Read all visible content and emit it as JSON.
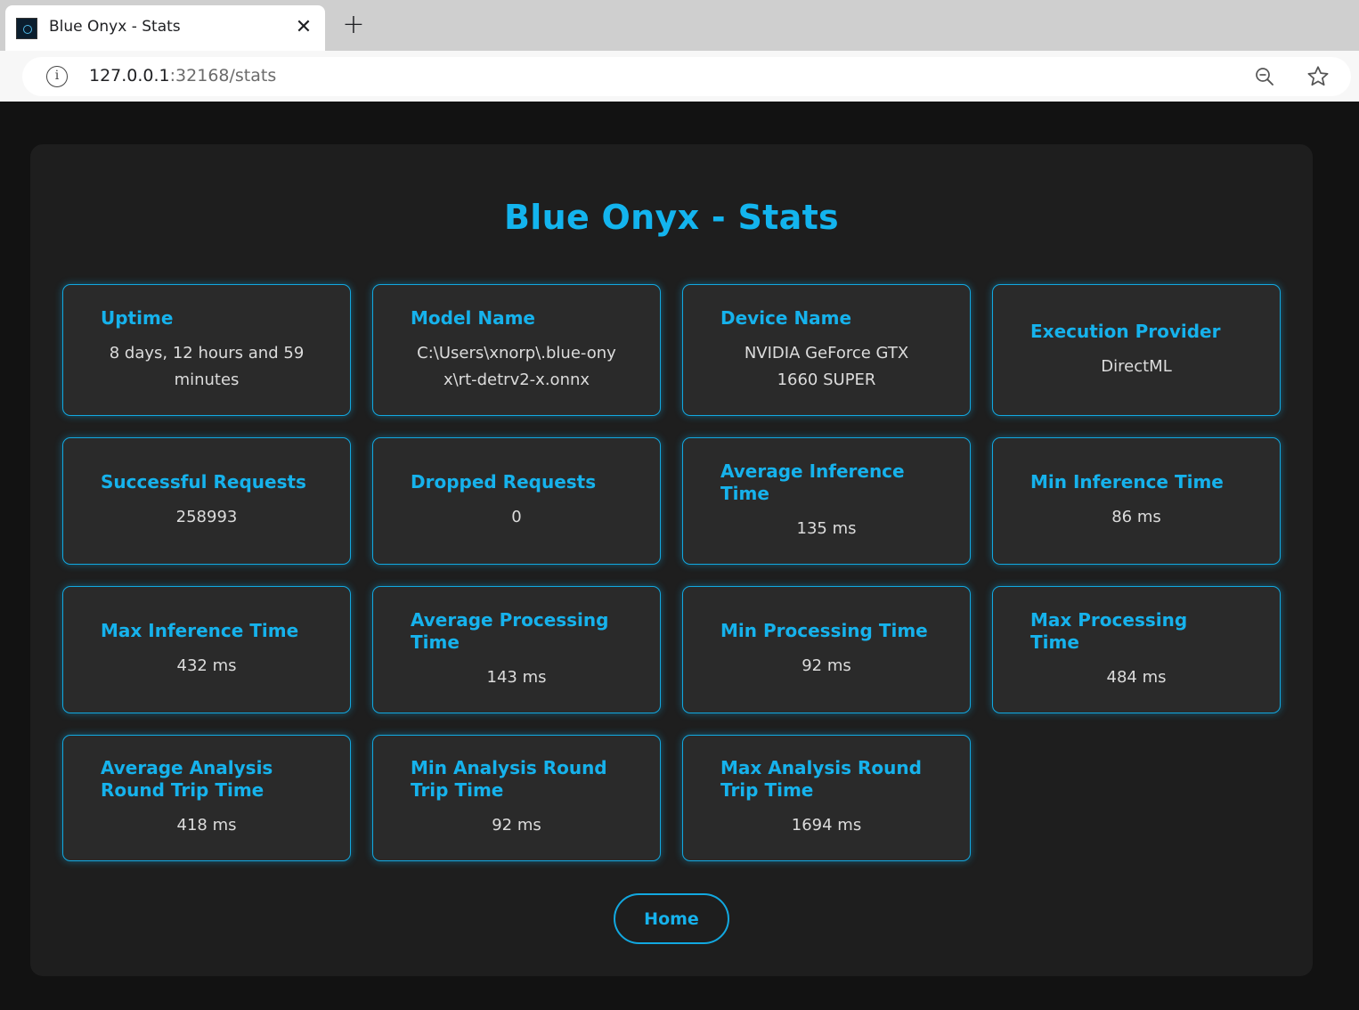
{
  "browser": {
    "tab_title": "Blue Onyx - Stats",
    "tab_close": "✕",
    "new_tab": "+",
    "url_host": "127.0.0.1",
    "url_rest": ":32168/stats"
  },
  "page": {
    "title": "Blue Onyx - Stats",
    "home_label": "Home"
  },
  "stats": [
    {
      "label": "Uptime",
      "value": "8 days, 12 hours and 59 minutes"
    },
    {
      "label": "Model Name",
      "value": "C:\\Users\\xnorp\\.blue-onyx\\rt-detrv2-x.onnx"
    },
    {
      "label": "Device Name",
      "value": "NVIDIA GeForce GTX 1660 SUPER"
    },
    {
      "label": "Execution Provider",
      "value": "DirectML"
    },
    {
      "label": "Successful Requests",
      "value": "258993"
    },
    {
      "label": "Dropped Requests",
      "value": "0"
    },
    {
      "label": "Average Inference Time",
      "value": "135 ms"
    },
    {
      "label": "Min Inference Time",
      "value": "86 ms"
    },
    {
      "label": "Max Inference Time",
      "value": "432 ms"
    },
    {
      "label": "Average Processing Time",
      "value": "143 ms"
    },
    {
      "label": "Min Processing Time",
      "value": "92 ms"
    },
    {
      "label": "Max Processing Time",
      "value": "484 ms"
    },
    {
      "label": "Average Analysis Round Trip Time",
      "value": "418 ms"
    },
    {
      "label": "Min Analysis Round Trip Time",
      "value": "92 ms"
    },
    {
      "label": "Max Analysis Round Trip Time",
      "value": "1694 ms"
    }
  ],
  "colors": {
    "accent": "#13b4ee",
    "card_bg": "#2a2a2a",
    "panel_bg": "#1e1e1e",
    "page_bg": "#121212"
  }
}
